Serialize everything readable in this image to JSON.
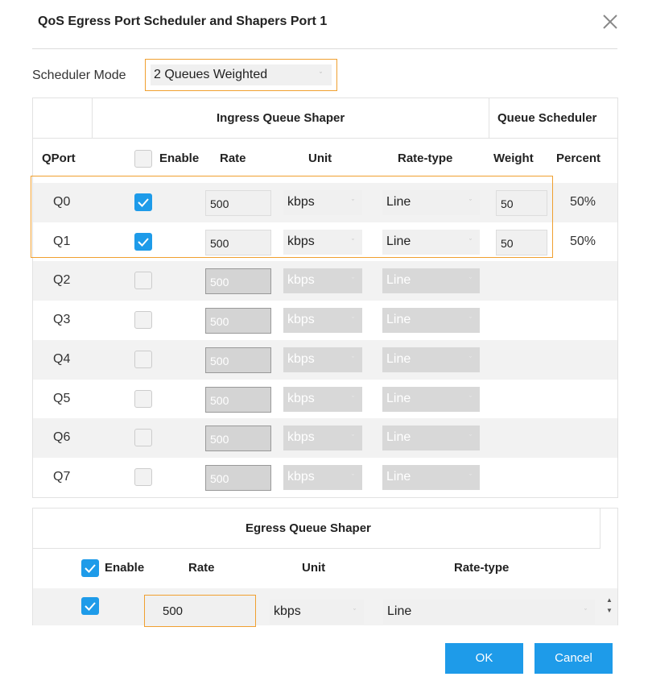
{
  "dialog": {
    "title": "QoS Egress Port Scheduler and Shapers Port 1",
    "close_icon": "close-icon"
  },
  "scheduler_mode": {
    "label": "Scheduler Mode",
    "value": "2 Queues Weighted",
    "caret": "ˇ"
  },
  "table": {
    "group_headers": {
      "ingress": "Ingress Queue Shaper",
      "scheduler": "Queue Scheduler"
    },
    "columns": {
      "qport": "QPort",
      "enable": "Enable",
      "rate": "Rate",
      "unit": "Unit",
      "rate_type": "Rate-type",
      "weight": "Weight",
      "percent": "Percent"
    },
    "rows": [
      {
        "q": "Q0",
        "enabled": true,
        "rate": "500",
        "unit": "kbps",
        "rate_type": "Line",
        "weight": "50",
        "percent": "50%"
      },
      {
        "q": "Q1",
        "enabled": true,
        "rate": "500",
        "unit": "kbps",
        "rate_type": "Line",
        "weight": "50",
        "percent": "50%"
      },
      {
        "q": "Q2",
        "enabled": false,
        "rate": "500",
        "unit": "kbps",
        "rate_type": "Line"
      },
      {
        "q": "Q3",
        "enabled": false,
        "rate": "500",
        "unit": "kbps",
        "rate_type": "Line"
      },
      {
        "q": "Q4",
        "enabled": false,
        "rate": "500",
        "unit": "kbps",
        "rate_type": "Line"
      },
      {
        "q": "Q5",
        "enabled": false,
        "rate": "500",
        "unit": "kbps",
        "rate_type": "Line"
      },
      {
        "q": "Q6",
        "enabled": false,
        "rate": "500",
        "unit": "kbps",
        "rate_type": "Line"
      },
      {
        "q": "Q7",
        "enabled": false,
        "rate": "500",
        "unit": "kbps",
        "rate_type": "Line"
      }
    ]
  },
  "egress": {
    "title": "Egress Queue Shaper",
    "columns": {
      "enable": "Enable",
      "rate": "Rate",
      "unit": "Unit",
      "rate_type": "Rate-type"
    },
    "header_enabled": true,
    "row": {
      "enabled": true,
      "rate": "500",
      "unit": "kbps",
      "rate_type": "Line"
    },
    "spinner_up": "▲",
    "spinner_down": "▼"
  },
  "buttons": {
    "ok": "OK",
    "cancel": "Cancel"
  },
  "colors": {
    "accent": "#1e9be9",
    "highlight": "#f0a030"
  }
}
